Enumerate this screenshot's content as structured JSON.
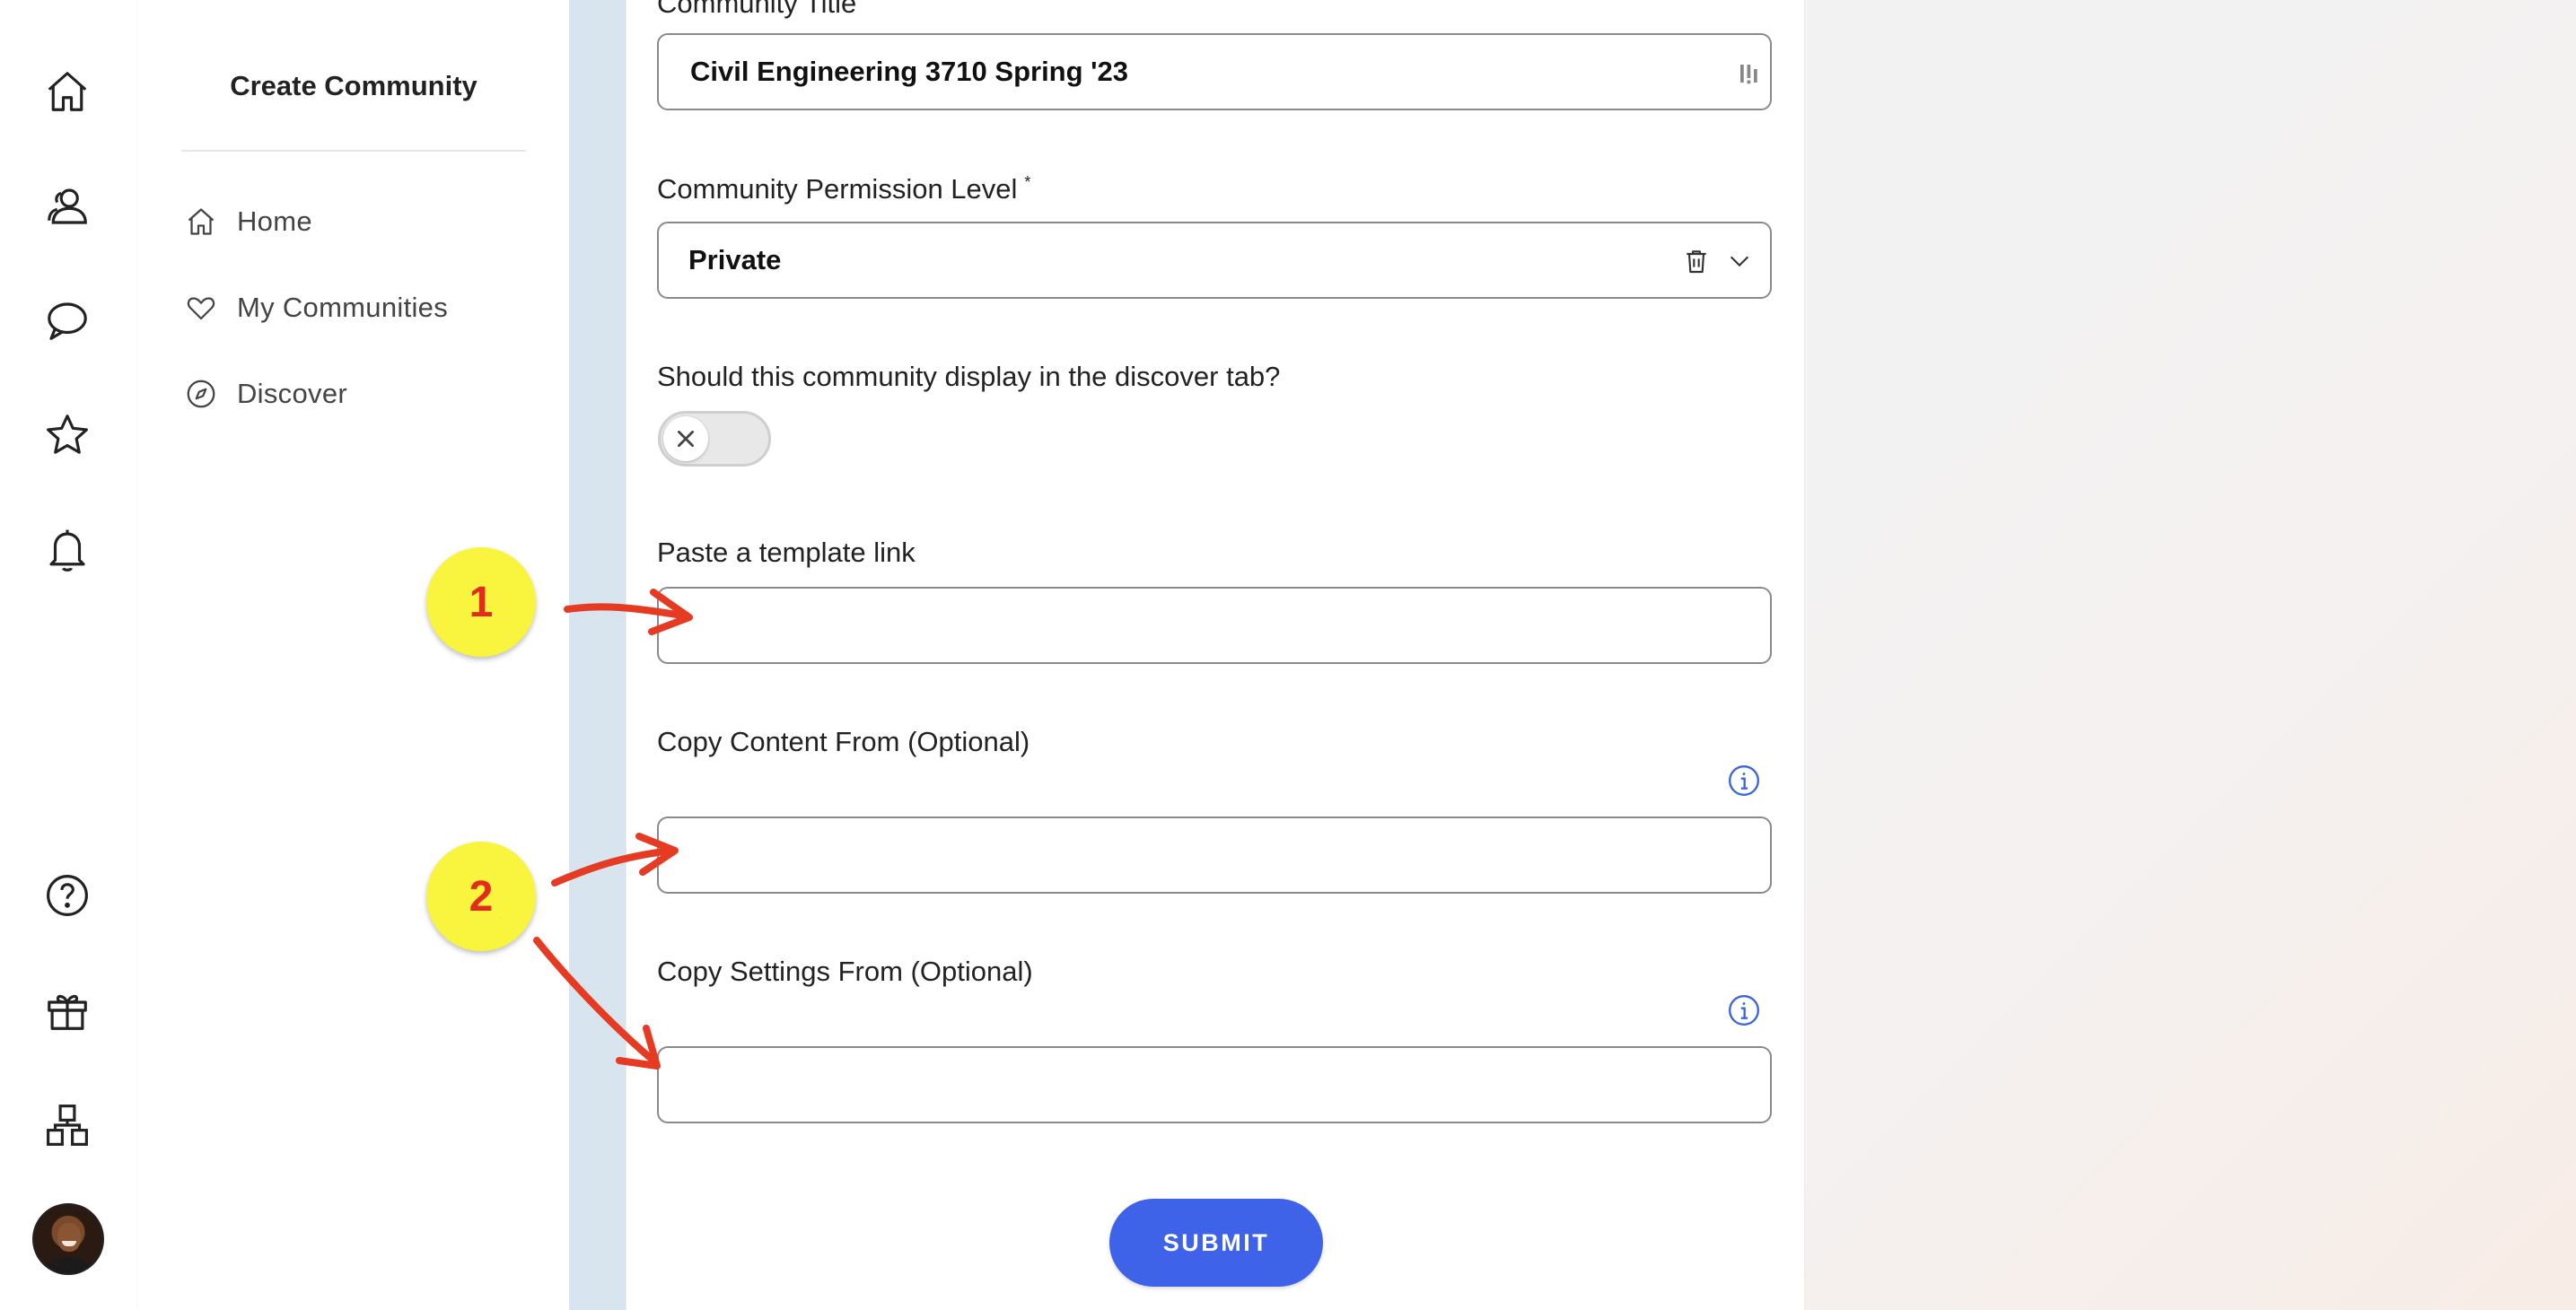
{
  "subnav": {
    "title": "Create Community",
    "items": [
      {
        "label": "Home",
        "icon": "home-icon"
      },
      {
        "label": "My Communities",
        "icon": "heart-icon"
      },
      {
        "label": "Discover",
        "icon": "compass-icon"
      }
    ]
  },
  "rail": {
    "icons": [
      "home-icon",
      "users-icon",
      "chat-icon",
      "star-icon",
      "bell-icon",
      "help-icon",
      "gift-icon",
      "apps-icon"
    ]
  },
  "form": {
    "title_label": "Community Title",
    "title_value": "Civil Engineering 3710 Spring '23",
    "permission_label": "Community Permission Level",
    "permission_value": "Private",
    "required_mark": "*",
    "discover_label": "Should this community display in the discover tab?",
    "discover_toggle_on": false,
    "template_label": "Paste a template link",
    "template_value": "",
    "copy_content_label": "Copy Content From (Optional)",
    "copy_content_value": "",
    "copy_settings_label": "Copy Settings From (Optional)",
    "copy_settings_value": "",
    "submit_label": "SUBMIT"
  },
  "annotations": [
    {
      "label": "1"
    },
    {
      "label": "2"
    }
  ],
  "colors": {
    "accent": "#3f63e8",
    "badge": "#f9f43e",
    "arrow": "#e53b22",
    "info": "#3a67d8"
  }
}
